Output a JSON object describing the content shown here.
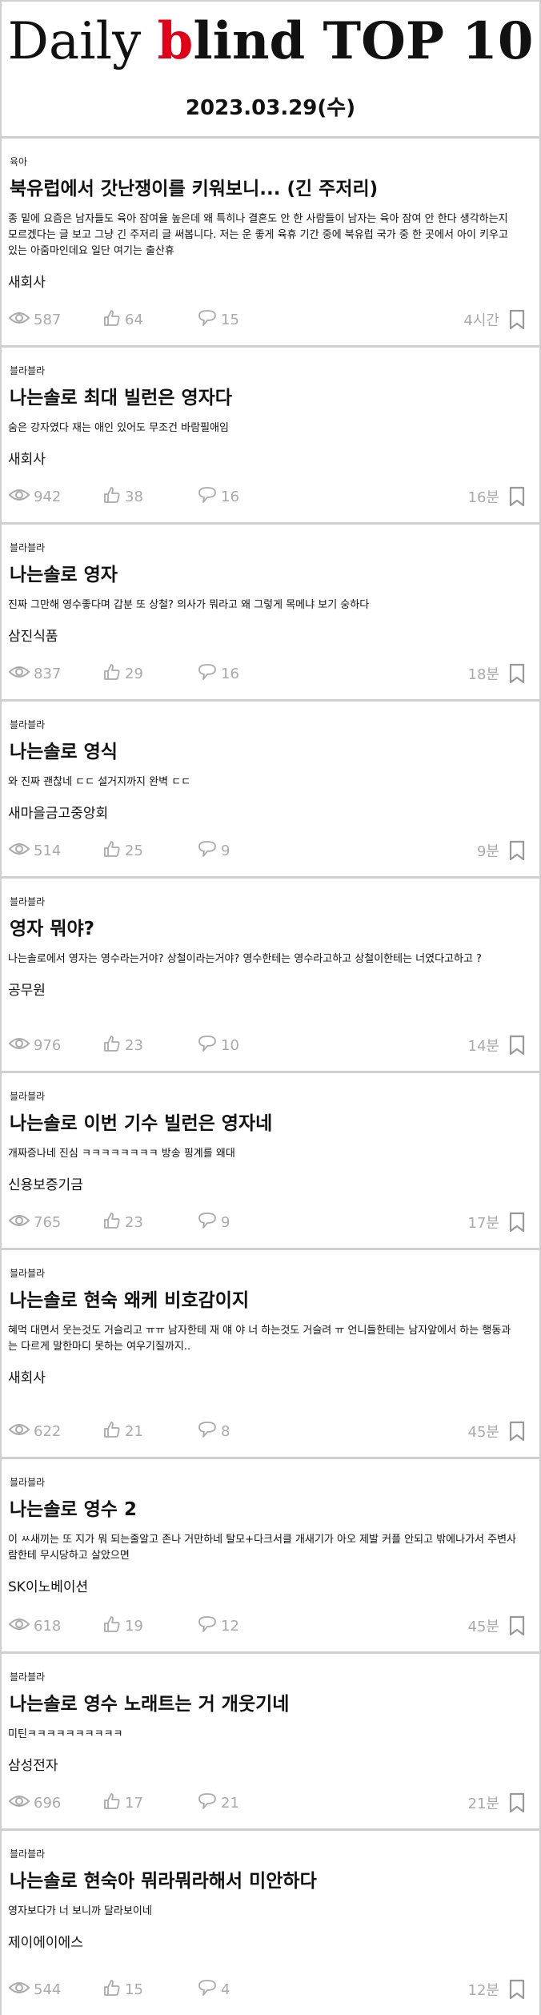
{
  "header": {
    "title_part1": "Daily ",
    "title_red": "b",
    "title_part2": "lind TOP 10",
    "date": "2023.03.29(수)"
  },
  "posts": [
    {
      "category": "육아",
      "title": "북유럽에서 갓난쟁이를 키워보니... (긴 주저리)",
      "excerpt": "종 밑에 요즘은 남자들도 육아 잠여율 높은데 왜 특히나 결혼도 안 한 사람들이 남자는 육아 잠여 안 한다 생각하는지 모르겠다는 글 보고 그냥 긴 주저리 글 써봅니다. 저는 운 좋게 육휴 기간 중에 북유럽 국가 중 한 곳에서 아이 키우고 있는 아줌마인데요  일단 여기는 출산휴",
      "company": "새회사",
      "views": "587",
      "likes": "64",
      "comments": "15",
      "time": "4시간"
    },
    {
      "category": "블라블라",
      "title": "나는솔로 최대 빌런은 영자다",
      "excerpt": "숨은 강자였다 재는 애인 있어도 무조건 바람필애임",
      "company": "새회사",
      "views": "942",
      "likes": "38",
      "comments": "16",
      "time": "16분"
    },
    {
      "category": "블라블라",
      "title": "나는솔로 영자",
      "excerpt": "진짜 그만해 영수좋다며 갑분 또 상철? 의사가 뭐라고 왜 그렇게 목메냐 보기 숭하다",
      "company": "삼진식품",
      "views": "837",
      "likes": "29",
      "comments": "16",
      "time": "18분"
    },
    {
      "category": "블라블라",
      "title": "나는솔로 영식",
      "excerpt": "와 진짜 괜찮네 ㄷㄷ 설거지까지 완벽 ㄷㄷ",
      "company": "새마을금고중앙회",
      "views": "514",
      "likes": "25",
      "comments": "9",
      "time": "9분"
    },
    {
      "category": "블라블라",
      "title": "영자 뭐야?",
      "excerpt": "나는솔로에서 영자는 영수라는거야?  상철이라는거야?  영수한테는 영수라고하고 상철이한테는 너였다고하고      ?",
      "company": "공무원",
      "views": "976",
      "likes": "23",
      "comments": "10",
      "time": "14분"
    },
    {
      "category": "블라블라",
      "title": "나는솔로 이번 기수 빌런은 영자네",
      "excerpt": "개짜증나네 진심 ㅋㅋㅋㅋㅋㅋㅋㅋ 방송 핑계를 왜대",
      "company": "신용보증기금",
      "views": "765",
      "likes": "23",
      "comments": "9",
      "time": "17분"
    },
    {
      "category": "블라블라",
      "title": "나는솔로 현숙 왜케 비호감이지",
      "excerpt": "혜먹 대면서 웃는것도 거슬리고 ㅠㅠ 남자한테 재 얘 야 너 하는것도 거슬려 ㅠ 언니들한테는 남자앞에서 하는 행동과는 다르게 말한마디 못하는 여우기질까지..",
      "company": "새회사",
      "views": "622",
      "likes": "21",
      "comments": "8",
      "time": "45분"
    },
    {
      "category": "블라블라",
      "title": "나는솔로 영수 2",
      "excerpt": "이 ㅆ새끼는 또 지가 뭐 되는줄알고 존나 거만하네 탈모+다크서클 개새기가 아오  제발 커플 안되고 밖에나가서 주변사람한테 무시당하고 살았으면",
      "company": "SK이노베이션",
      "views": "618",
      "likes": "19",
      "comments": "12",
      "time": "45분"
    },
    {
      "category": "블라블라",
      "title": "나는솔로 영수 노래트는 거 개웃기네",
      "excerpt": "미틴ㅋㅋㅋㅋㅋㅋㅋㅋㅋㅋ",
      "company": "삼성전자",
      "views": "696",
      "likes": "17",
      "comments": "21",
      "time": "21분"
    },
    {
      "category": "블라블라",
      "title": "나는솔로 현숙아 뭐라뭐라해서 미안하다",
      "excerpt": "영자보다가 너 보니까 달라보이네",
      "company": "제이에이에스",
      "views": "544",
      "likes": "15",
      "comments": "4",
      "time": "12분"
    }
  ],
  "icons": {
    "views": "eye-icon",
    "likes": "thumbs-up-icon",
    "comments": "speech-bubble-icon",
    "bookmark": "bookmark-icon"
  },
  "colors": {
    "brand_red": "#e0001a",
    "stat_gray": "#aaaaaa"
  }
}
